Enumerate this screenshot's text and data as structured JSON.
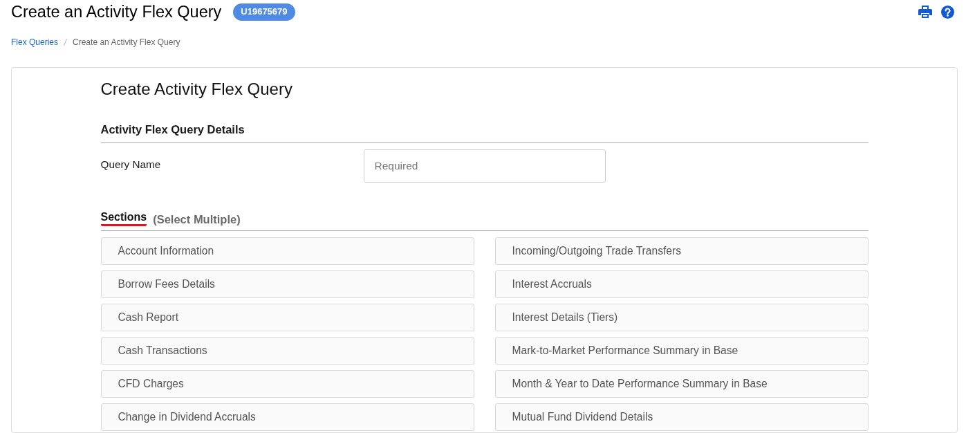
{
  "header": {
    "title": "Create an Activity Flex Query",
    "account_id": "U19675679"
  },
  "breadcrumb": [
    {
      "label": "Flex Queries",
      "current": false
    },
    {
      "label": "Create an Activity Flex Query",
      "current": true
    }
  ],
  "form": {
    "title": "Create Activity Flex Query",
    "details_heading": "Activity Flex Query Details",
    "fields": [
      {
        "label": "Query Name",
        "placeholder": "Required"
      }
    ],
    "sections": {
      "heading": "Sections",
      "hint": "(Select Multiple)",
      "columns": [
        {
          "items": [
            {
              "label": "Account Information",
              "selected": false
            },
            {
              "label": "Borrow Fees Details",
              "selected": false
            },
            {
              "label": "Cash Report",
              "selected": false
            },
            {
              "label": "Cash Transactions",
              "selected": false
            },
            {
              "label": "CFD Charges",
              "selected": false
            },
            {
              "label": "Change in Dividend Accruals",
              "selected": false
            }
          ]
        },
        {
          "items": [
            {
              "label": "Incoming/Outgoing Trade Transfers",
              "selected": false
            },
            {
              "label": "Interest Accruals",
              "selected": false
            },
            {
              "label": "Interest Details (Tiers)",
              "selected": false
            },
            {
              "label": "Mark-to-Market Performance Summary in Base",
              "selected": false
            },
            {
              "label": "Month & Year to Date Performance Summary in Base",
              "selected": false
            },
            {
              "label": "Mutual Fund Dividend Details",
              "selected": false
            }
          ]
        }
      ]
    }
  }
}
